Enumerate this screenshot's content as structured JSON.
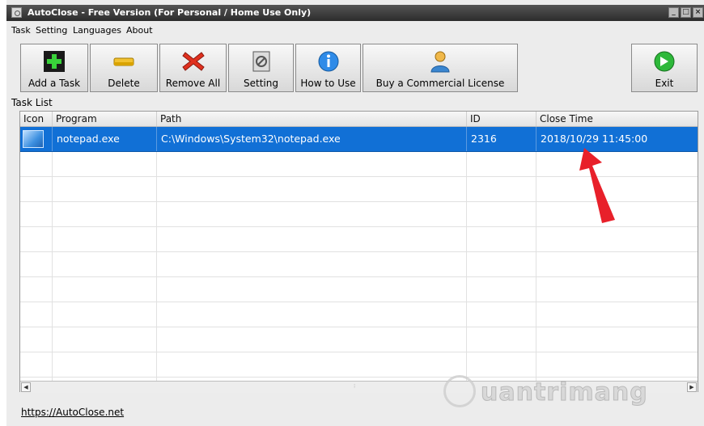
{
  "window": {
    "title": "AutoClose - Free Version (For Personal / Home Use Only)",
    "min_label": "_",
    "max_label": "□",
    "close_label": "×"
  },
  "menu": [
    "Task",
    "Setting",
    "Languages",
    "About"
  ],
  "toolbar": {
    "add": "Add a Task",
    "delete": "Delete",
    "remove_all": "Remove All",
    "setting": "Setting",
    "how_to": "How to Use",
    "buy": "Buy a Commercial License",
    "exit": "Exit"
  },
  "task_list": {
    "label": "Task List",
    "columns": [
      "Icon",
      "Program",
      "Path",
      "ID",
      "Close Time"
    ],
    "rows": [
      {
        "icon": "notepad-icon",
        "program": "notepad.exe",
        "path": "C:\\Windows\\System32\\notepad.exe",
        "id": "2316",
        "close_time": "2018/10/29 11:45:00"
      }
    ]
  },
  "footer": {
    "link": "https://AutoClose.net"
  },
  "watermark": {
    "text": "uantrimang"
  },
  "colors": {
    "selection": "#1170d6",
    "annotation_arrow": "#e8202a",
    "titlebar": "#3a3a3a"
  }
}
